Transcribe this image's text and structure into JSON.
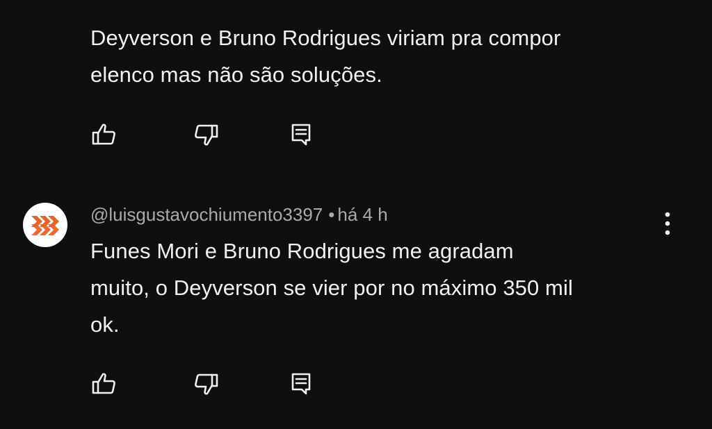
{
  "comments": [
    {
      "text": "Deyverson e Bruno Rodrigues viriam pra compor\nelenco mas não são soluções.",
      "actions": {
        "like_icon": "thumb-up-icon",
        "dislike_icon": "thumb-down-icon",
        "reply_icon": "reply-icon"
      }
    },
    {
      "author": "@luisgustavochiumento3397",
      "separator": "•",
      "time": "há 4 h",
      "avatar_icon": "orange-chevrons-logo",
      "avatar_colors": {
        "background": "#ffffff",
        "logo": "#e8622c"
      },
      "text": "Funes Mori e Bruno Rodrigues me agradam\nmuito, o Deyverson se vier por no máximo 350 mil\nok.",
      "more_icon": "more-vertical-icon",
      "actions": {
        "like_icon": "thumb-up-icon",
        "dislike_icon": "thumb-down-icon",
        "reply_icon": "reply-icon"
      }
    }
  ],
  "theme": {
    "background": "#0f0f0f",
    "text": "#f1f1f1",
    "secondary_text": "#aaaaaa"
  }
}
